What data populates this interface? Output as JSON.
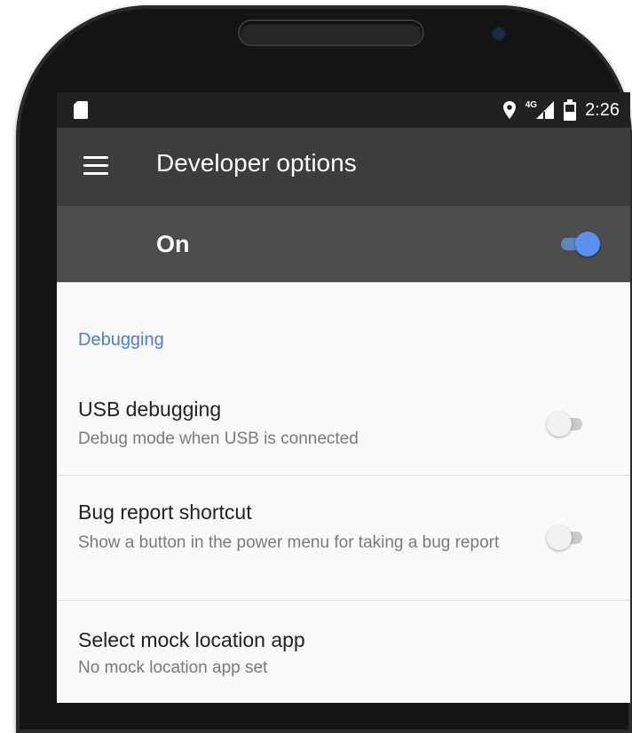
{
  "status_bar": {
    "time": "2:26",
    "network": "4G",
    "icons": [
      "sd-card-icon",
      "location-icon",
      "signal-icon",
      "battery-icon"
    ]
  },
  "toolbar": {
    "title": "Developer options",
    "menu_icon": "menu-icon"
  },
  "master_switch": {
    "label": "On",
    "state": true
  },
  "category": "Debugging",
  "items": [
    {
      "title": "USB debugging",
      "summary": "Debug mode when USB is connected",
      "switch": false
    },
    {
      "title": "Bug report shortcut",
      "summary": "Show a button in the power menu for taking a bug report",
      "switch": false
    },
    {
      "title": "Select mock location app",
      "summary": "No mock location app set"
    }
  ],
  "colors": {
    "accent": "#4a7fd6",
    "toolbar": "#3d3d3d",
    "switch_bar": "#4d4d4d",
    "status_bar": "#212121"
  }
}
